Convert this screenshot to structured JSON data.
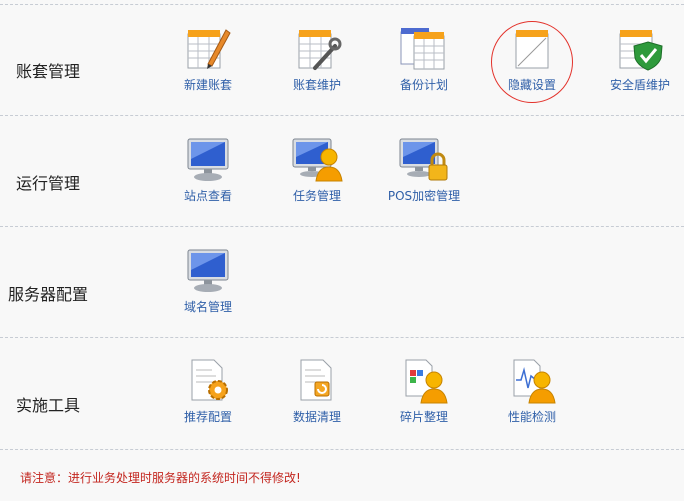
{
  "sections": [
    {
      "label": "账套管理",
      "tools": [
        {
          "label": "新建账套",
          "icon": "new-ledger-icon"
        },
        {
          "label": "账套维护",
          "icon": "ledger-maintenance-icon"
        },
        {
          "label": "备份计划",
          "icon": "backup-plan-icon"
        },
        {
          "label": "隐藏设置",
          "icon": "hidden-settings-icon"
        },
        {
          "label": "安全盾维护",
          "icon": "security-shield-icon"
        }
      ]
    },
    {
      "label": "运行管理",
      "tools": [
        {
          "label": "站点查看",
          "icon": "monitor-icon"
        },
        {
          "label": "任务管理",
          "icon": "task-user-icon"
        },
        {
          "label": "POS加密管理",
          "icon": "monitor-lock-icon"
        }
      ]
    },
    {
      "label": "服务器配置",
      "tools": [
        {
          "label": "域名管理",
          "icon": "monitor-icon"
        }
      ]
    },
    {
      "label": "实施工具",
      "tools": [
        {
          "label": "推荐配置",
          "icon": "document-gear-icon"
        },
        {
          "label": "数据清理",
          "icon": "document-refresh-icon"
        },
        {
          "label": "碎片整理",
          "icon": "fragment-user-icon"
        },
        {
          "label": "性能检测",
          "icon": "performance-user-icon"
        }
      ]
    }
  ],
  "notice": "请注意：进行业务处理时服务器的系统时间不得修改!",
  "colors": {
    "link": "#2f5fa8",
    "notice": "#c3261f",
    "highlight": "#e3322b"
  }
}
